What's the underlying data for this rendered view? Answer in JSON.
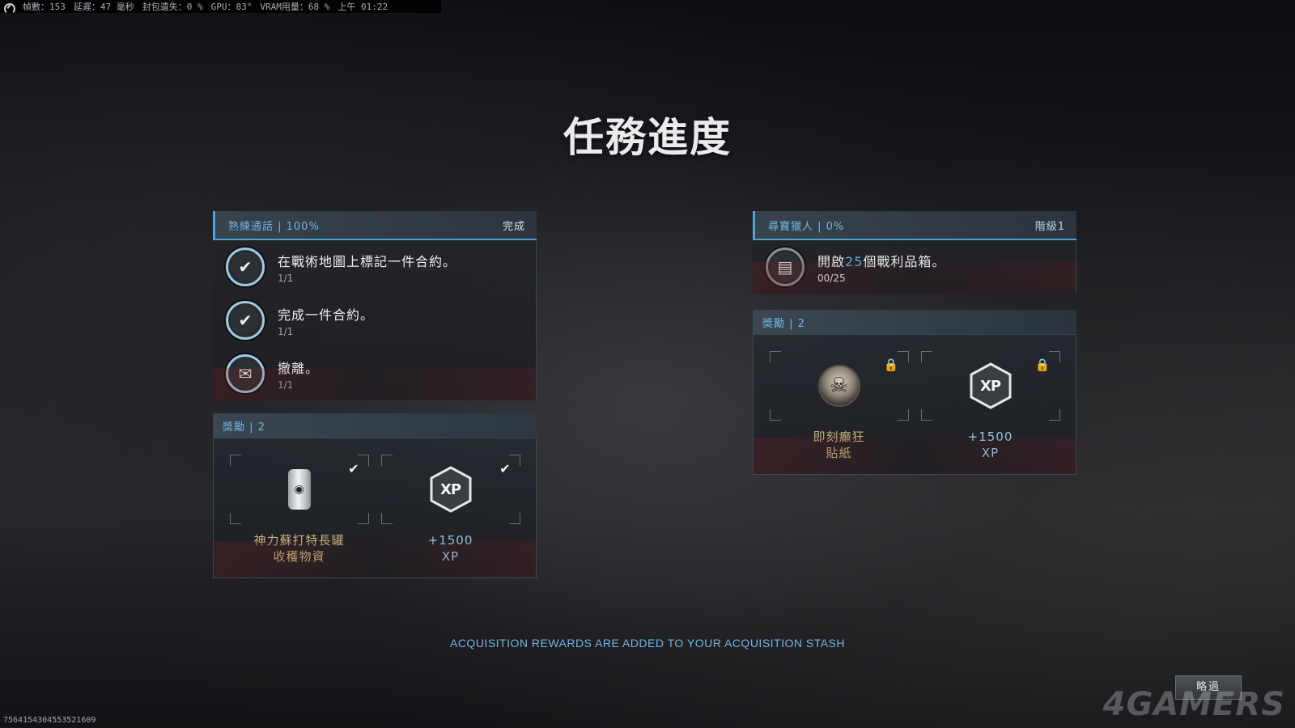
{
  "stats": {
    "fps_label": "幀數：153",
    "latency_label": "延遲：47 毫秒",
    "packet_loss_label": "封包遺失：0 %",
    "gpu_label": "GPU：83°",
    "vram_label": "VRAM用量：68 %",
    "clock": "上午 01:22"
  },
  "title": "任務進度",
  "left_panel": {
    "header": "熟練通話 | 100%",
    "status": "完成",
    "tasks": [
      {
        "label": "在戰術地圖上標記一件合約。",
        "progress": "1/1",
        "icon": "contract-icon"
      },
      {
        "label": "完成一件合約。",
        "progress": "1/1",
        "icon": "contract-icon"
      },
      {
        "label": "撤離。",
        "progress": "1/1",
        "icon": "exfil-icon"
      }
    ],
    "rewards_header": "獎勵 | 2",
    "rewards": [
      {
        "name_line1": "神力蘇打特長罐",
        "name_line2": "收穫物資",
        "icon": "soda-can-icon",
        "state": "claimed"
      },
      {
        "name_line1": "+1500",
        "name_line2": "XP",
        "icon": "xp-icon",
        "state": "claimed"
      }
    ]
  },
  "right_panel": {
    "header": "尋寶獵人 | 0%",
    "status": "階級1",
    "task": {
      "label_prefix": "開啟",
      "label_highlight": "25",
      "label_suffix": "個戰利品箱。",
      "progress": "00/25",
      "icon": "loot-box-icon"
    },
    "rewards_header": "獎勵 | 2",
    "rewards": [
      {
        "name_line1": "即刻癲狂",
        "name_line2": "貼紙",
        "icon": "skull-sticker-icon",
        "state": "locked"
      },
      {
        "name_line1": "+1500",
        "name_line2": "XP",
        "icon": "xp-icon",
        "state": "locked"
      }
    ]
  },
  "footer_note": "ACQUISITION REWARDS ARE ADDED TO YOUR ACQUISITION STASH",
  "skip_label": "略過",
  "watermark": "4GAMERS",
  "session_id": "7564154304553521609",
  "colors": {
    "accent_blue": "#4fa6d6",
    "reward_gold": "#c8b27c",
    "reward_blue": "#9bc6e0"
  }
}
